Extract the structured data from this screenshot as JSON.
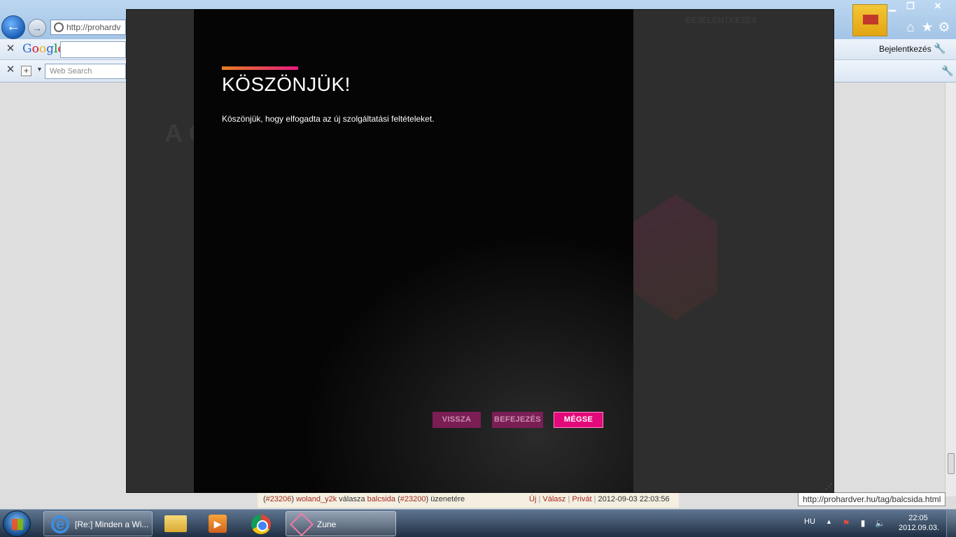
{
  "browser": {
    "address_url": "http://prohardv",
    "google_label": "Google",
    "websearch_placeholder": "Web Search",
    "signin_label": "Bejelentkezés",
    "tooltip_url": "http://prohardver.hu/tag/balcsida.html"
  },
  "background_page": {
    "ghost_title": "A C ZE",
    "ghost_login": "BEJELENTKEZÉS",
    "bottom_strip": {
      "id1": "#23206",
      "user1": "woland_y2k",
      "mid": "válasza",
      "user2": "balcsida",
      "id2": "#23200",
      "tail": "üzenetére",
      "links": [
        "Új",
        "Válasz",
        "Privát"
      ],
      "datetime": "2012-09-03 22:03:56"
    }
  },
  "dialog": {
    "title": "KÖSZÖNJÜK!",
    "message": "Köszönjük, hogy elfogadta az új szolgáltatási feltételeket.",
    "buttons": {
      "back": "VISSZA",
      "finish": "BEFEJEZÉS",
      "cancel": "MÉGSE"
    },
    "accent_colors": [
      "#e67e22",
      "#e51a7f"
    ]
  },
  "taskbar": {
    "ie_task_label": "[Re:] Minden a Wi...",
    "zune_task_label": "Zune",
    "language": "HU",
    "time": "22:05",
    "date": "2012.09.03."
  }
}
